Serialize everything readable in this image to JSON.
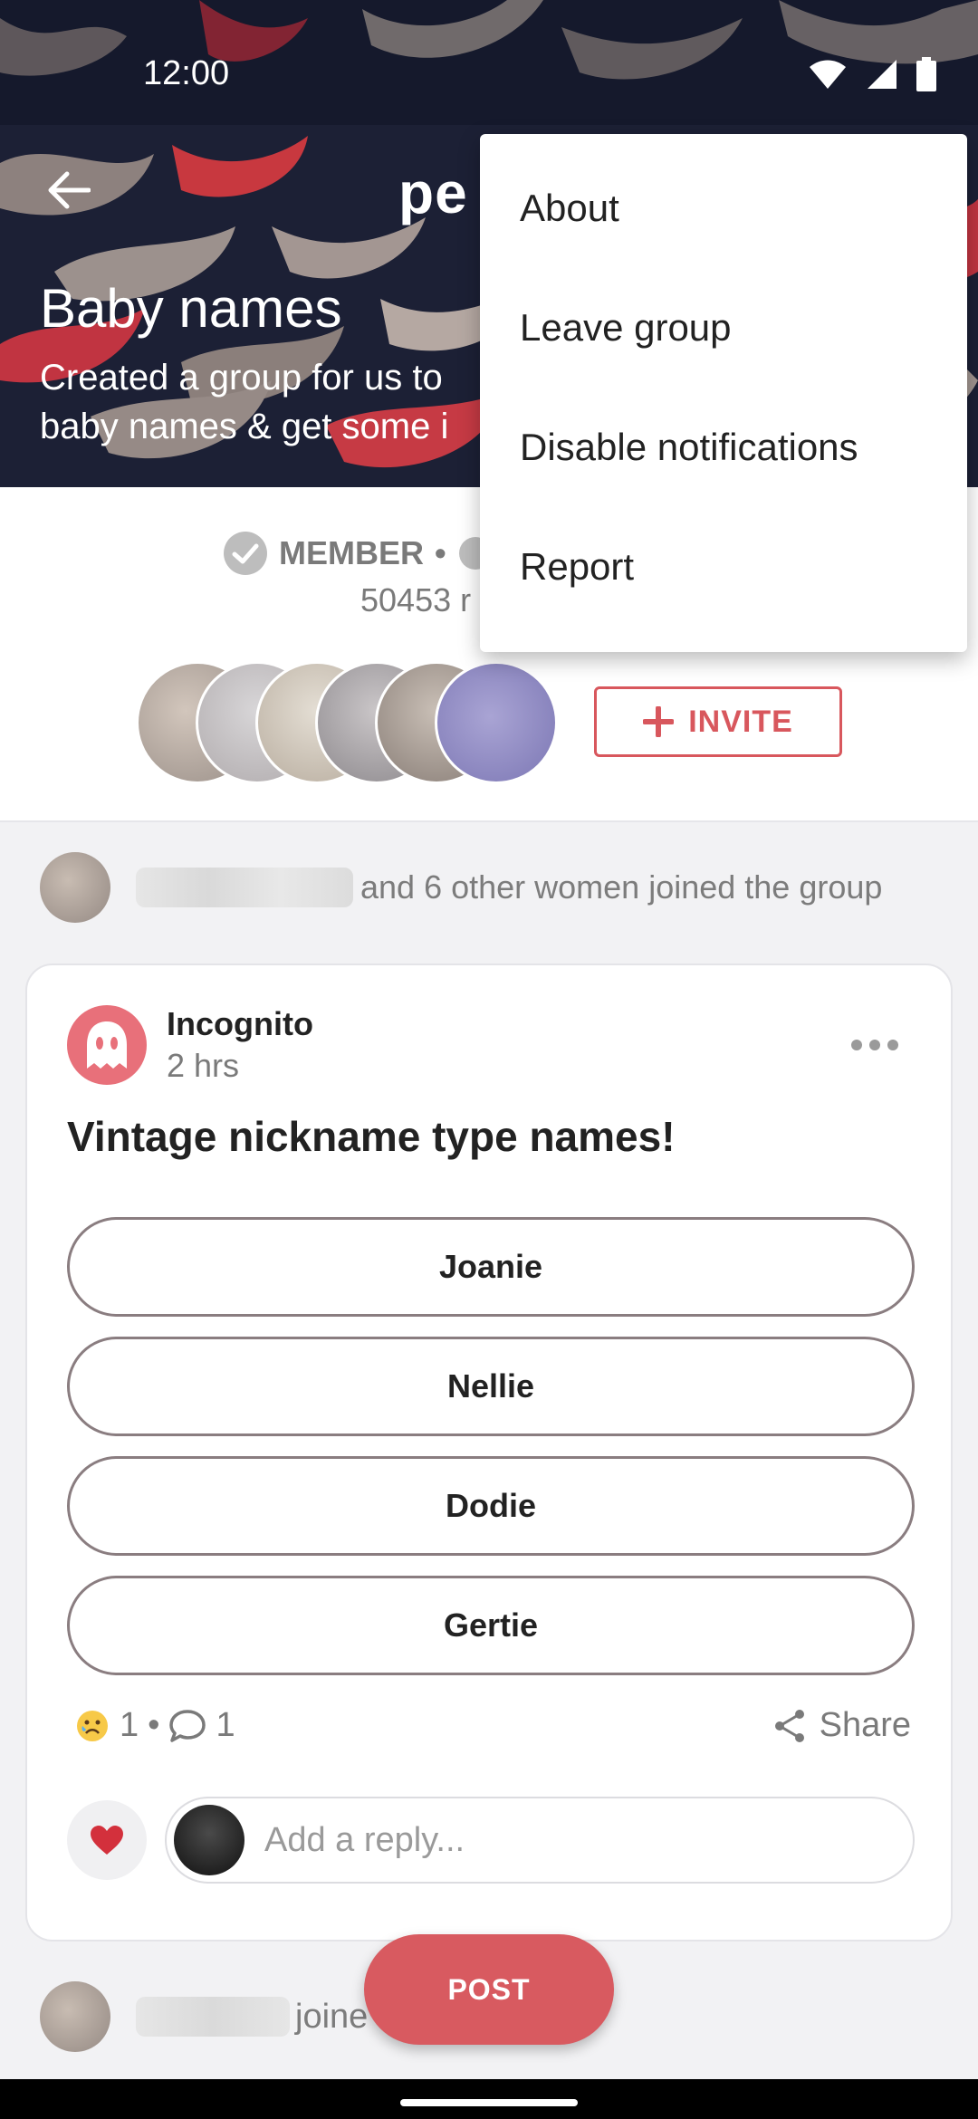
{
  "status_bar": {
    "time": "12:00"
  },
  "header": {
    "brand": "pe",
    "group_title": "Baby names",
    "group_description_line1": "Created a group for us to",
    "group_description_line2": "baby names & get some i"
  },
  "info": {
    "membership": "MEMBER",
    "separator": "•",
    "member_count": "50453 r",
    "invite_label": "INVITE"
  },
  "activity": {
    "text": "and 6 other women joined the group"
  },
  "post": {
    "author": "Incognito",
    "time": "2 hrs",
    "title": "Vintage nickname type names!",
    "options": [
      "Joanie",
      "Nellie",
      "Dodie",
      "Gertie"
    ],
    "reaction_count": "1",
    "separator": "•",
    "comment_count": "1",
    "share_label": "Share",
    "reply_placeholder": "Add a reply..."
  },
  "bottom_activity": {
    "text": "joine"
  },
  "fab": {
    "label": "POST"
  },
  "menu": {
    "items": [
      "About",
      "Leave group",
      "Disable notifications",
      "Report"
    ]
  },
  "colors": {
    "accent": "#d8575d",
    "header_bg": "#1c2035",
    "fab": "#d85a60"
  }
}
